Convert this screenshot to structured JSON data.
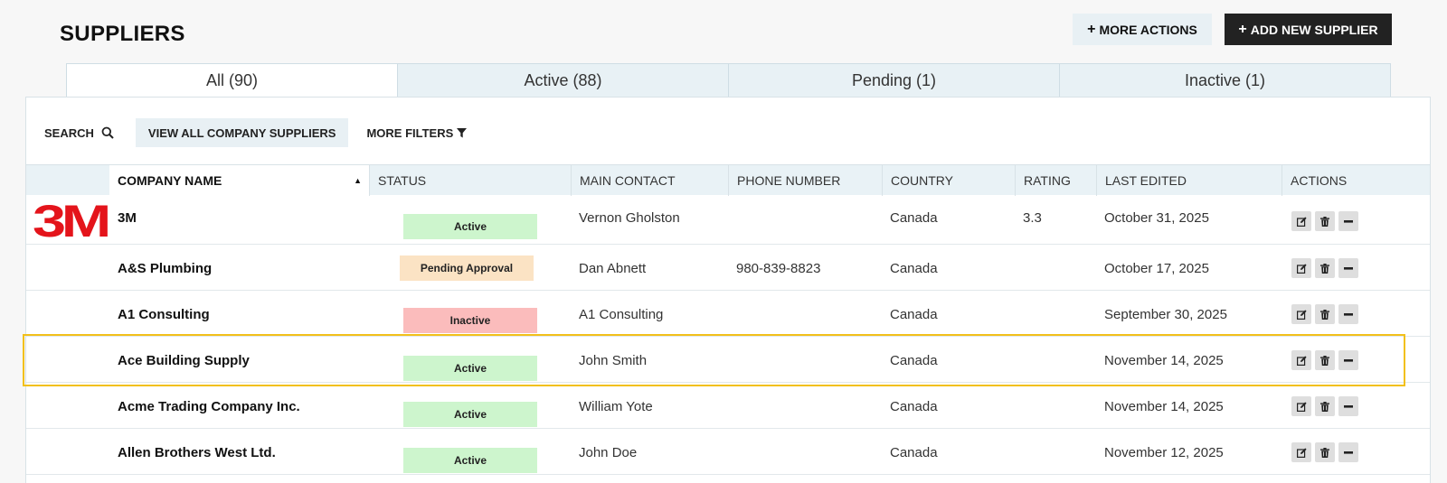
{
  "header": {
    "title": "SUPPLIERS",
    "more_actions_label": "MORE ACTIONS",
    "add_supplier_label": "ADD NEW SUPPLIER"
  },
  "tabs": [
    {
      "label": "All (90)"
    },
    {
      "label": "Active (88)"
    },
    {
      "label": "Pending (1)"
    },
    {
      "label": "Inactive (1)"
    }
  ],
  "filters": {
    "search_label": "SEARCH",
    "view_all_label": "VIEW ALL COMPANY SUPPLIERS",
    "more_filters_label": "MORE FILTERS"
  },
  "columns": {
    "company": "COMPANY NAME",
    "status": "STATUS",
    "contact": "MAIN CONTACT",
    "phone": "PHONE NUMBER",
    "country": "COUNTRY",
    "rating": "RATING",
    "edited": "LAST EDITED",
    "actions": "ACTIONS"
  },
  "rows": [
    {
      "logo": "3M",
      "company": "3M",
      "status": "Active",
      "contact": "Vernon Gholston",
      "phone": "",
      "country": "Canada",
      "rating": "3.3",
      "edited": "October 31, 2025"
    },
    {
      "company": "A&S Plumbing",
      "status": "Pending Approval",
      "contact": "Dan Abnett",
      "phone": "980-839-8823",
      "country": "Canada",
      "rating": "",
      "edited": "October 17, 2025"
    },
    {
      "company": "A1 Consulting",
      "status": "Inactive",
      "contact": "A1 Consulting",
      "phone": "",
      "country": "Canada",
      "rating": "",
      "edited": "September 30, 2025"
    },
    {
      "company": "Ace Building Supply",
      "status": "Active",
      "contact": "John Smith",
      "phone": "",
      "country": "Canada",
      "rating": "",
      "edited": "November 14, 2025"
    },
    {
      "company": "Acme Trading Company Inc.",
      "status": "Active",
      "contact": "William Yote",
      "phone": "",
      "country": "Canada",
      "rating": "",
      "edited": "November 14, 2025"
    },
    {
      "company": "Allen Brothers West Ltd.",
      "status": "Active",
      "contact": "John Doe",
      "phone": "",
      "country": "Canada",
      "rating": "",
      "edited": "November 12, 2025"
    }
  ],
  "status_colors": {
    "Active": "#cdf5cd",
    "Pending Approval": "#fbe3c4",
    "Inactive": "#fbbcbc"
  },
  "brand_colors": {
    "logo_3m": "#e4141b",
    "primary_button": "#222222",
    "highlight": "#f2c01a"
  },
  "icons": {
    "add": "plus-icon",
    "search": "search-icon",
    "filter": "filter-icon",
    "edit": "edit-icon",
    "delete": "trash-icon",
    "collapse": "minus-icon",
    "sort": "sort-up-icon"
  }
}
